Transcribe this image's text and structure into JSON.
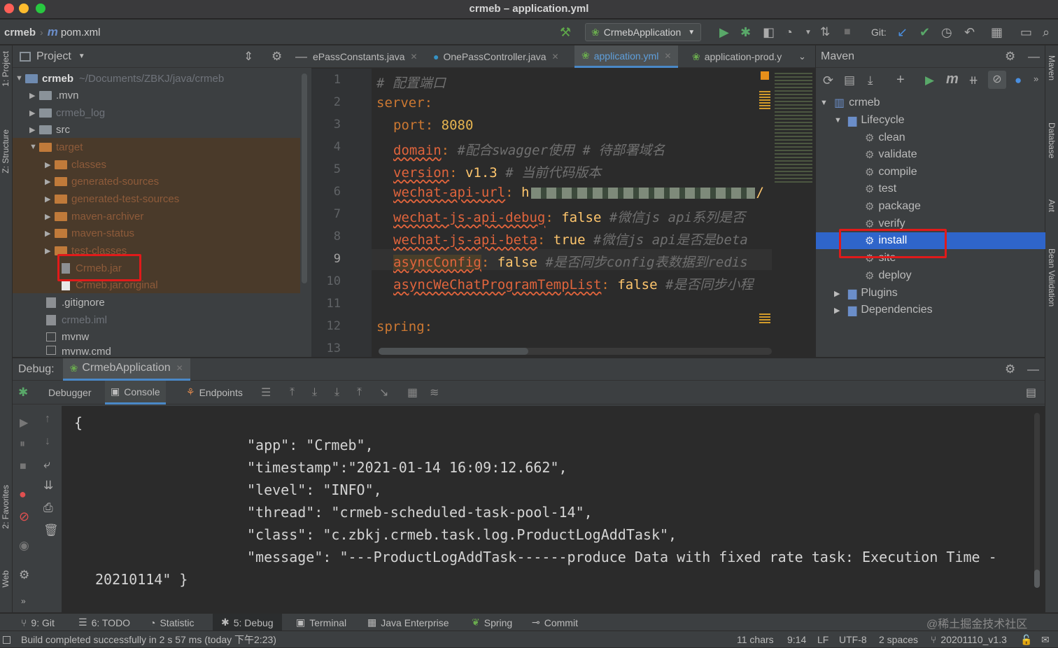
{
  "window": {
    "title": "crmeb – application.yml"
  },
  "nav": {
    "project": "crmeb",
    "file": "pom.xml",
    "run_config": "CrmebApplication",
    "git_label": "Git:"
  },
  "project_panel": {
    "title": "Project",
    "root": {
      "name": "crmeb",
      "path": "~/Documents/ZBKJ/java/crmeb"
    },
    "items": [
      {
        "label": ".mvn"
      },
      {
        "label": "crmeb_log"
      },
      {
        "label": "src"
      },
      {
        "label": "target"
      },
      {
        "label": "classes"
      },
      {
        "label": "generated-sources"
      },
      {
        "label": "generated-test-sources"
      },
      {
        "label": "maven-archiver"
      },
      {
        "label": "maven-status"
      },
      {
        "label": "test-classes"
      },
      {
        "label": "Crmeb.jar"
      },
      {
        "label": "Crmeb.jar.original"
      },
      {
        "label": ".gitignore"
      },
      {
        "label": "crmeb.iml"
      },
      {
        "label": "mvnw"
      },
      {
        "label": "mvnw.cmd"
      }
    ]
  },
  "editor": {
    "tabs": [
      {
        "label": "ePassConstants.java"
      },
      {
        "label": "OnePassController.java"
      },
      {
        "label": "application.yml"
      },
      {
        "label": "application-prod.y"
      }
    ],
    "line_numbers": [
      "1",
      "2",
      "3",
      "4",
      "5",
      "6",
      "7",
      "8",
      "9",
      "10",
      "11",
      "12",
      "13"
    ],
    "lines": {
      "l1_comment": "# 配置端口",
      "l2_key": "server",
      "l3_key": "port",
      "l3_val": "8080",
      "l4_key": "domain",
      "l4_comment": "#配合swagger使用 # 待部署域名",
      "l5_key": "version",
      "l5_val": "v1.3",
      "l5_comment": "# 当前代码版本",
      "l6_key": "wechat-api-url",
      "l6_val": "h",
      "l6_tail": "/",
      "l7_key": "wechat-js-api-debug",
      "l7_val": "false",
      "l7_comment": "#微信js api系列是否",
      "l8_key": "wechat-js-api-beta",
      "l8_val": "true",
      "l8_comment": "#微信js api是否是beta",
      "l9_key": "asyncConfig",
      "l9_val": "false",
      "l9_comment": "#是否同步config表数据到redis",
      "l10_key": "asyncWeChatProgramTempList",
      "l10_val": "false",
      "l10_comment": "#是否同步小程",
      "l12_key": "spring"
    }
  },
  "maven": {
    "title": "Maven",
    "root": "crmeb",
    "lifecycle": "Lifecycle",
    "phases": [
      "clean",
      "validate",
      "compile",
      "test",
      "package",
      "verify",
      "install",
      "site",
      "deploy"
    ],
    "plugins": "Plugins",
    "dependencies": "Dependencies"
  },
  "debug": {
    "label": "Debug:",
    "session": "CrmebApplication",
    "tabs": {
      "debugger": "Debugger",
      "console": "Console",
      "endpoints": "Endpoints"
    },
    "console_lines": [
      "{",
      "\"app\": \"Crmeb\",",
      "\"timestamp\":\"2021-01-14 16:09:12.662\",",
      "\"level\": \"INFO\",",
      "\"thread\": \"crmeb-scheduled-task-pool-14\",",
      "\"class\": \"c.zbkj.crmeb.task.log.ProductLogAddTask\",",
      "\"message\": \"---ProductLogAddTask------produce Data with fixed rate task: Execution Time -",
      "20210114\" }"
    ]
  },
  "left_strip": {
    "project": "1: Project",
    "structure": "Z: Structure",
    "favorites": "2: Favorites",
    "web": "Web"
  },
  "right_strip": {
    "maven": "Maven",
    "database": "Database",
    "ant": "Ant",
    "bean": "Bean Validation"
  },
  "toolwindows": {
    "git": "9: Git",
    "todo": "6: TODO",
    "statistic": "Statistic",
    "debug": "5: Debug",
    "terminal": "Terminal",
    "java_enterprise": "Java Enterprise",
    "spring": "Spring",
    "commit": "Commit"
  },
  "watermark": "@稀土掘金技术社区",
  "status": {
    "message": "Build completed successfully in 2 s 57 ms (today 下午2:23)",
    "chars": "11 chars",
    "position": "9:14",
    "line_sep": "LF",
    "encoding": "UTF-8",
    "indent": "2 spaces",
    "branch": "20201110_v1.3"
  },
  "colors": {
    "accent": "#2f65ca",
    "highlight_box": "#e01a1a",
    "keyword": "#cc7832",
    "string": "#ffc66d"
  }
}
